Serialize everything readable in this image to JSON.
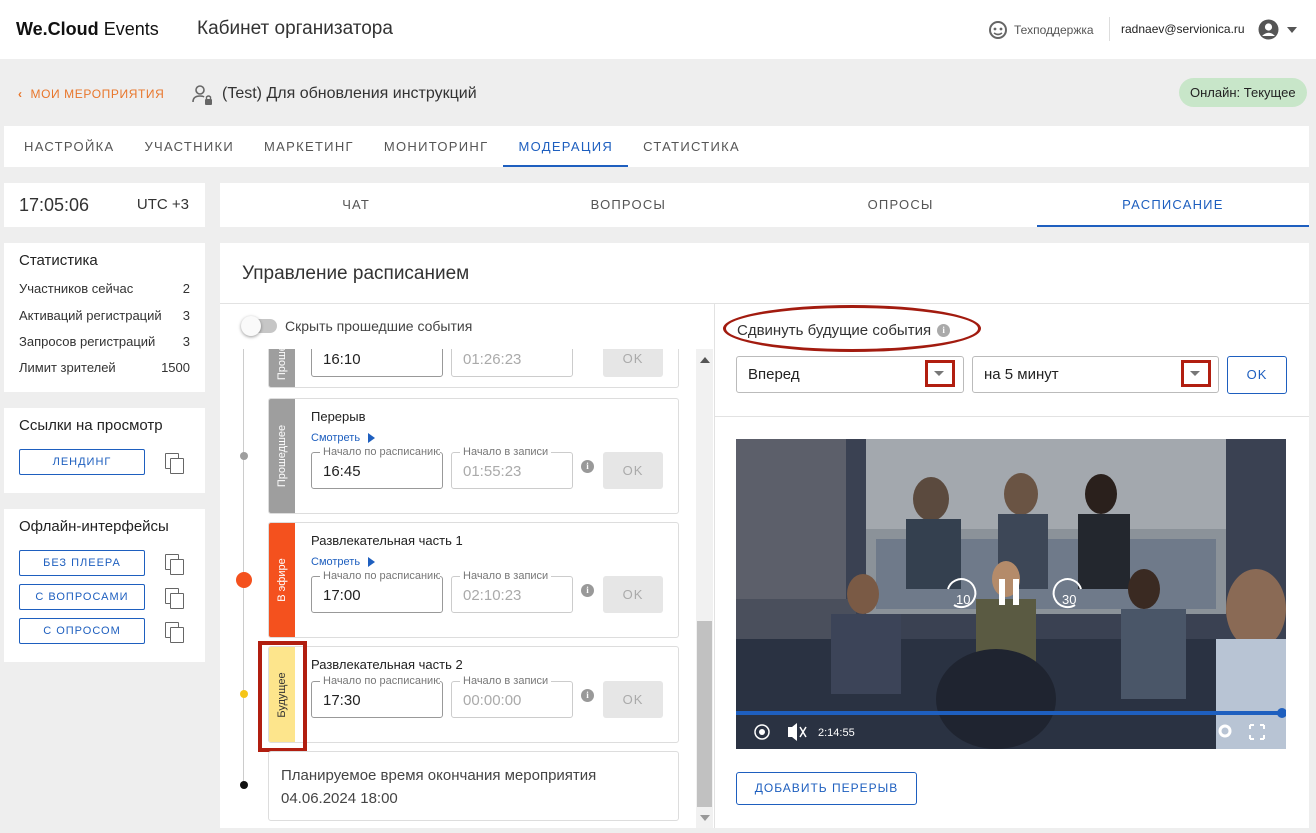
{
  "header": {
    "logo_brand": "We.Cloud",
    "logo_product": "Events",
    "cabinet_title": "Кабинет организатора",
    "support_label": "Техподдержка",
    "user_email": "radnaev@servionica.ru"
  },
  "event": {
    "back_label": "МОИ МЕРОПРИЯТИЯ",
    "title": "(Test) Для обновления инструкций",
    "status_badge": "Онлайн: Текущее"
  },
  "main_tabs": [
    "НАСТРОЙКА",
    "УЧАСТНИКИ",
    "МАРКЕТИНГ",
    "МОНИТОРИНГ",
    "МОДЕРАЦИЯ",
    "СТАТИСТИКА"
  ],
  "active_main_tab": "МОДЕРАЦИЯ",
  "clock": {
    "time": "17:05:06",
    "zone": "UTC +3"
  },
  "stats": {
    "title": "Статистика",
    "rows": [
      {
        "label": "Участников сейчас",
        "value": "2"
      },
      {
        "label": "Активаций регистраций",
        "value": "3"
      },
      {
        "label": "Запросов регистраций",
        "value": "3"
      },
      {
        "label": "Лимит зрителей",
        "value": "1500"
      }
    ]
  },
  "view_links": {
    "title": "Ссылки на просмотр",
    "landing": "ЛЕНДИНГ"
  },
  "offline": {
    "title": "Офлайн-интерфейсы",
    "buttons": [
      "БЕЗ ПЛЕЕРА",
      "С ВОПРОСАМИ",
      "С ОПРОСОМ"
    ]
  },
  "sub_tabs": [
    "ЧАТ",
    "ВОПРОСЫ",
    "ОПРОСЫ",
    "РАСПИСАНИЕ"
  ],
  "active_sub_tab": "РАСПИСАНИЕ",
  "schedule": {
    "title": "Управление расписанием",
    "hide_past_label": "Скрыть прошедшие события",
    "watch_label": "Смотреть",
    "start_label": "Начало по расписанию",
    "record_label": "Начало в записи",
    "ok_label": "OK",
    "partial_event": {
      "status": "Прошедшее",
      "start": "16:10",
      "record": "01:26:23"
    },
    "events": [
      {
        "status": "Прошедшее",
        "status_color": "#9e9e9e",
        "name": "Перерыв",
        "start": "16:45",
        "record": "01:55:23"
      },
      {
        "status": "В эфире",
        "status_color": "#f4511e",
        "name": "Развлекательная часть 1",
        "start": "17:00",
        "record": "02:10:23"
      },
      {
        "status": "Будущее",
        "status_color": "#fde58c",
        "name": "Развлекательная часть 2",
        "start": "17:30",
        "record": "00:00:00"
      }
    ],
    "end_label": "Планируемое время окончания мероприятия",
    "end_value": "04.06.2024 18:00"
  },
  "shift": {
    "label": "Сдвинуть будущие события",
    "direction": "Вперед",
    "amount": "на 5 минут",
    "ok": "OK"
  },
  "player": {
    "time": "2:14:55",
    "rewind": "10",
    "forward": "30",
    "progress_fraction": 0.995
  },
  "add_break": "ДОБАВИТЬ ПЕРЕРЫВ",
  "colors": {
    "accent": "#1e5fbf",
    "orange": "#e8762b",
    "highlight": "#b11e10",
    "live": "#f4511e",
    "future": "#fde58c"
  }
}
